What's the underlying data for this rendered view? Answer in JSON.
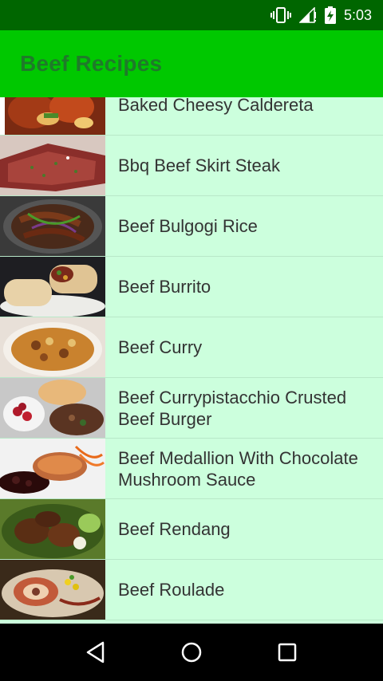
{
  "status_bar": {
    "time": "5:03",
    "icons": [
      "vibrate-icon",
      "signal-icon",
      "battery-charging-icon"
    ]
  },
  "app_bar": {
    "title": "Beef Recipes"
  },
  "recipes": [
    {
      "label": "Baked Cheesy Caldereta",
      "thumb": "caldereta-thumbnail"
    },
    {
      "label": "Bbq Beef Skirt Steak",
      "thumb": "skirt-steak-thumbnail"
    },
    {
      "label": "Beef Bulgogi Rice",
      "thumb": "bulgogi-thumbnail"
    },
    {
      "label": "Beef Burrito",
      "thumb": "burrito-thumbnail"
    },
    {
      "label": "Beef Curry",
      "thumb": "curry-thumbnail"
    },
    {
      "label": "Beef Currypistacchio Crusted Beef Burger",
      "thumb": "burger-thumbnail"
    },
    {
      "label": "Beef Medallion With Chocolate Mushroom Sauce",
      "thumb": "medallion-thumbnail"
    },
    {
      "label": "Beef Rendang",
      "thumb": "rendang-thumbnail"
    },
    {
      "label": "Beef Roulade",
      "thumb": "roulade-thumbnail"
    }
  ],
  "nav_bar": {
    "icons": [
      "back-icon",
      "home-icon",
      "recents-icon"
    ]
  },
  "colors": {
    "status_bar": "#006600",
    "app_bar": "#00c800",
    "list_background": "#ccffdd",
    "nav_bar": "#000000"
  }
}
